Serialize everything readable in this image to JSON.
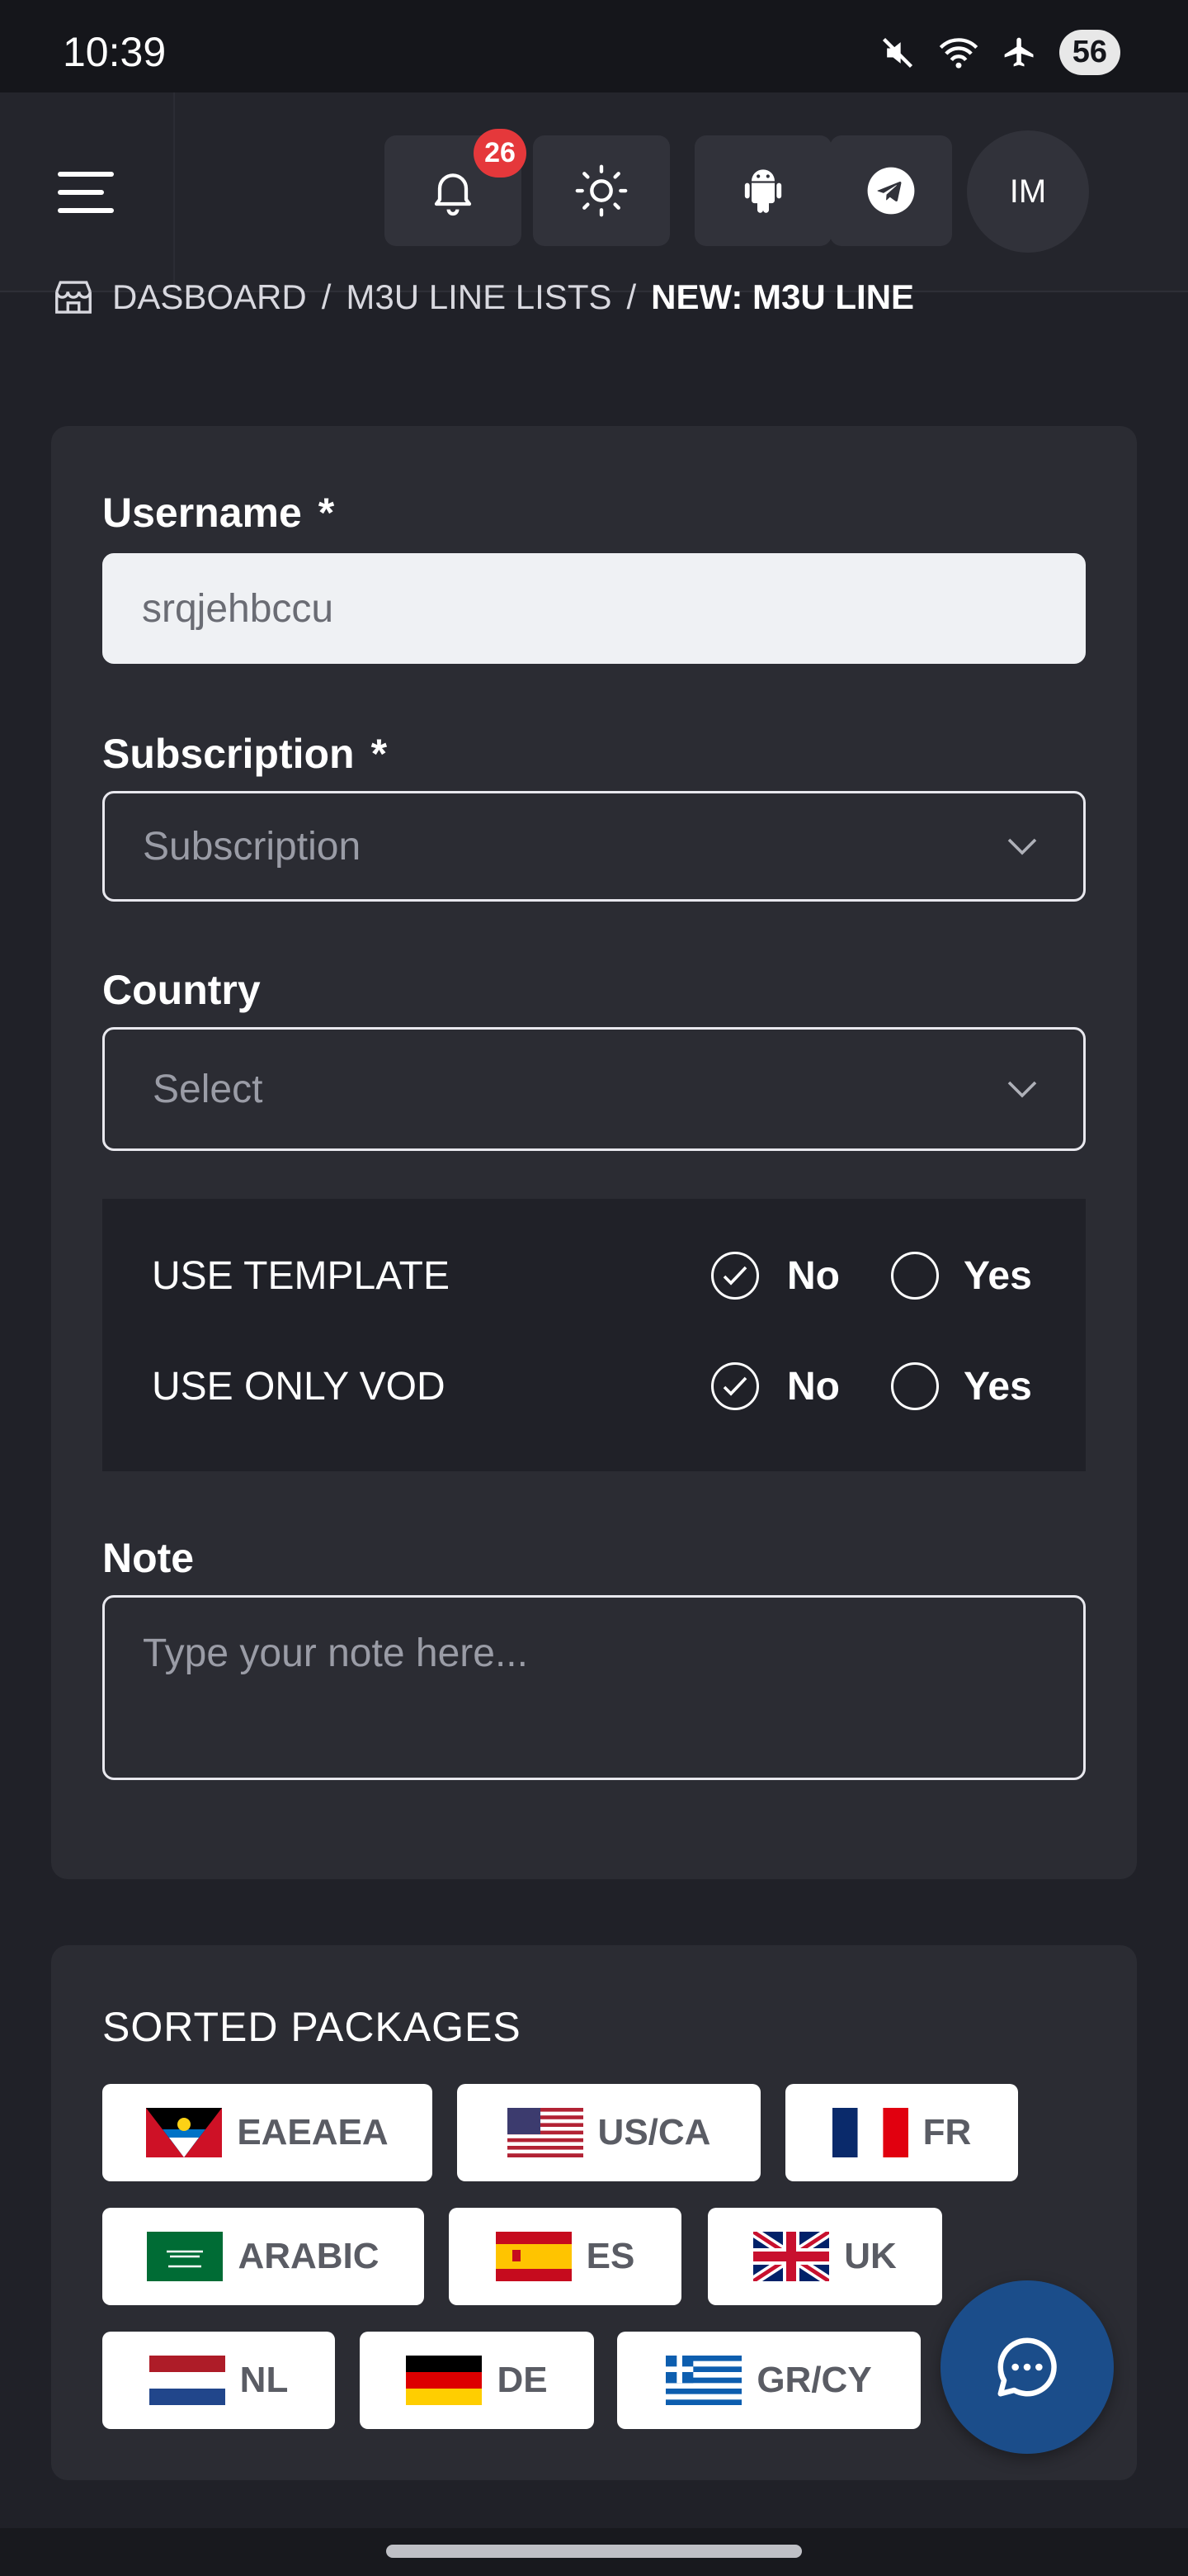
{
  "status_bar": {
    "time": "10:39",
    "battery": "56"
  },
  "header": {
    "notification_count": "26",
    "avatar_initials": "IM"
  },
  "breadcrumb": {
    "items": [
      "DASBOARD",
      "M3U LINE LISTS"
    ],
    "current": "NEW: M3U LINE",
    "separator": "/"
  },
  "form": {
    "username": {
      "label": "Username",
      "required_mark": "*",
      "value": "srqjehbccu"
    },
    "subscription": {
      "label": "Subscription",
      "required_mark": "*",
      "placeholder": "Subscription"
    },
    "country": {
      "label": "Country",
      "placeholder": "Select"
    },
    "options": [
      {
        "label": "USE TEMPLATE",
        "no_label": "No",
        "yes_label": "Yes",
        "selected": "No"
      },
      {
        "label": "USE ONLY VOD",
        "no_label": "No",
        "yes_label": "Yes",
        "selected": "No"
      }
    ],
    "note": {
      "label": "Note",
      "placeholder": "Type your note here..."
    }
  },
  "packages": {
    "title": "SORTED PACKAGES",
    "items": [
      {
        "label": "EAEAEA",
        "flag": "antigua-barbuda-flag"
      },
      {
        "label": "US/CA",
        "flag": "usa-flag"
      },
      {
        "label": "FR",
        "flag": "france-flag"
      },
      {
        "label": "ARABIC",
        "flag": "saudi-arabia-flag"
      },
      {
        "label": "ES",
        "flag": "spain-flag"
      },
      {
        "label": "UK",
        "flag": "uk-flag"
      },
      {
        "label": "NL",
        "flag": "netherlands-flag"
      },
      {
        "label": "DE",
        "flag": "germany-flag"
      },
      {
        "label": "GR/CY",
        "flag": "greece-flag"
      }
    ]
  },
  "colors": {
    "background": "#202128",
    "card": "#2b2c33",
    "badge": "#e5383b",
    "chat_fab": "#1b4d8a"
  }
}
